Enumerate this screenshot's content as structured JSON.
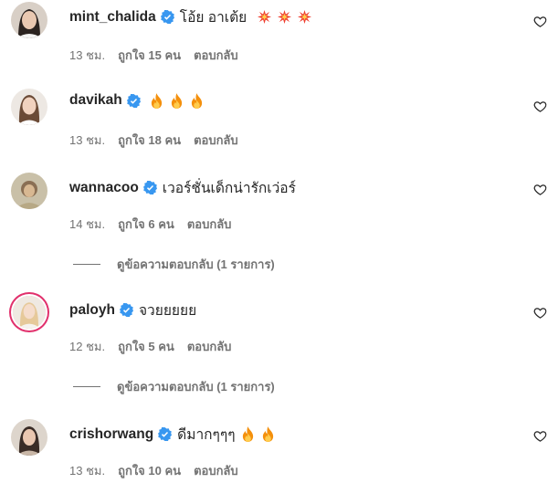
{
  "colors": {
    "text": "#262626",
    "muted": "#737373",
    "verified": "#3897f0",
    "story_ring": "#e1306c"
  },
  "comments": [
    {
      "username": "mint_chalida",
      "verified": true,
      "text": "โอ้ย อาเต้ย",
      "emojis": [
        "collision",
        "collision",
        "collision"
      ],
      "time": "13 ชม.",
      "likes": "ถูกใจ 15 คน",
      "reply": "ตอบกลับ",
      "view_replies": null
    },
    {
      "username": "davikah",
      "verified": true,
      "text": "",
      "emojis": [
        "fire",
        "fire",
        "fire"
      ],
      "time": "13 ชม.",
      "likes": "ถูกใจ 18 คน",
      "reply": "ตอบกลับ",
      "view_replies": null
    },
    {
      "username": "wannacoo",
      "verified": true,
      "text": "เวอร์ชั่นเด็กน่ารักเว่อร์",
      "emojis": [],
      "time": "14 ชม.",
      "likes": "ถูกใจ 6 คน",
      "reply": "ตอบกลับ",
      "view_replies": "ดูข้อความตอบกลับ (1 รายการ)"
    },
    {
      "username": "paloyh",
      "verified": true,
      "text": "จวยยยยย",
      "emojis": [],
      "time": "12 ชม.",
      "likes": "ถูกใจ 5 คน",
      "reply": "ตอบกลับ",
      "view_replies": "ดูข้อความตอบกลับ (1 รายการ)"
    },
    {
      "username": "crishorwang",
      "verified": true,
      "text": "ดีมากๆๆๆ",
      "emojis": [
        "fire",
        "fire"
      ],
      "time": "13 ชม.",
      "likes": "ถูกใจ 10 คน",
      "reply": "ตอบกลับ",
      "view_replies": null
    }
  ]
}
